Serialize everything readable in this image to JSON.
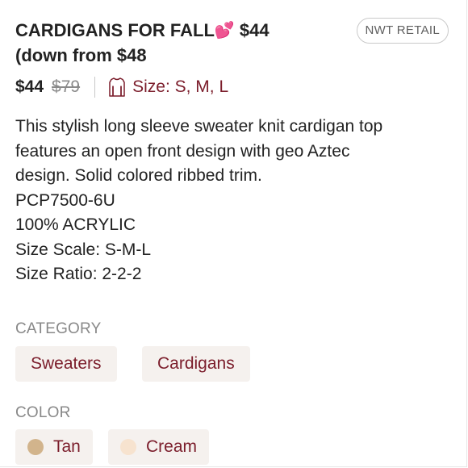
{
  "listing": {
    "title_line1": "CARDIGANS FOR FALL",
    "title_emoji": "💕",
    "title_price": "$44",
    "title_line2": "(down from $48",
    "condition_badge": "NWT RETAIL"
  },
  "price": {
    "current": "$44",
    "original": "$79",
    "size_label": "Size: S, M, L"
  },
  "description": {
    "lines": [
      "This stylish long sleeve sweater knit cardigan top",
      "features an open front design with geo Aztec",
      "design. Solid colored ribbed trim.",
      "PCP7500-6U",
      "100% ACRYLIC",
      "Size Scale: S-M-L",
      "Size Ratio: 2-2-2"
    ]
  },
  "category": {
    "label": "CATEGORY",
    "items": [
      "Sweaters",
      "Cardigans"
    ]
  },
  "color": {
    "label": "COLOR",
    "items": [
      {
        "name": "Tan",
        "hex": "#d2b48c"
      },
      {
        "name": "Cream",
        "hex": "#f7e3cf"
      }
    ]
  },
  "theme": {
    "accent": "#7b1d2b",
    "chip_bg": "#f5f1ee",
    "muted": "#888888"
  }
}
